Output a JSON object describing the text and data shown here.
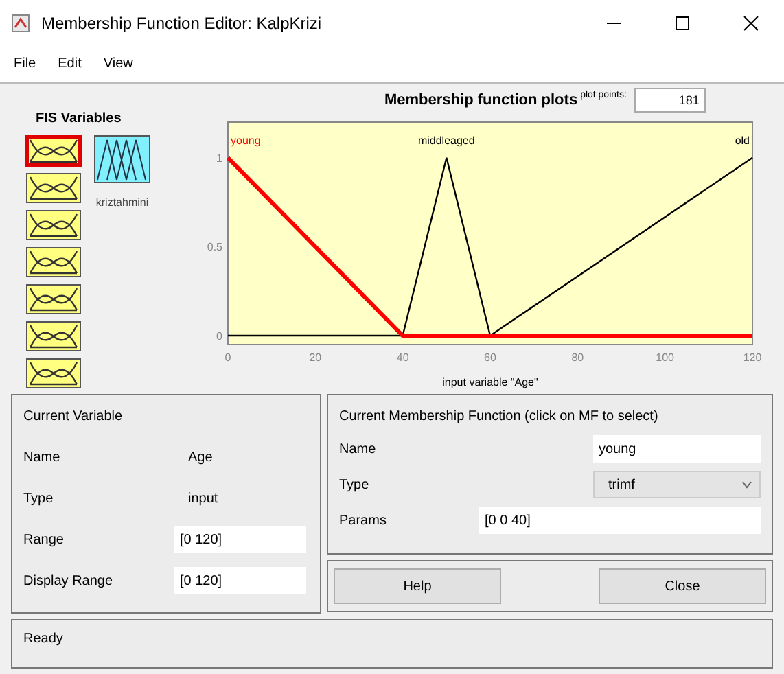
{
  "window": {
    "title": "Membership Function Editor: KalpKrizi"
  },
  "menu": [
    "File",
    "Edit",
    "View"
  ],
  "fis_variables": {
    "title": "FIS Variables",
    "inputs": [
      {
        "selected": true
      },
      {
        "selected": false
      },
      {
        "selected": false
      },
      {
        "selected": false
      },
      {
        "selected": false
      },
      {
        "selected": false
      },
      {
        "selected": false
      }
    ],
    "outputs": [
      {
        "label": "kriztahmini",
        "selected": false
      }
    ]
  },
  "plot": {
    "plot_points_label": "plot points:",
    "plot_points": "181",
    "chart_data": {
      "type": "line",
      "title": "Membership function plots",
      "xlabel": "input variable \"Age\"",
      "x": [
        0,
        40,
        50,
        60,
        120
      ],
      "series": [
        {
          "name": "young",
          "color": "#ff0000",
          "values": [
            1,
            0,
            0,
            0,
            0
          ]
        },
        {
          "name": "middleaged",
          "color": "#000000",
          "values": [
            null,
            0,
            1,
            0,
            null
          ]
        },
        {
          "name": "old",
          "color": "#000000",
          "values": [
            null,
            null,
            null,
            0,
            1
          ]
        }
      ],
      "xlim": [
        0,
        120
      ],
      "ylim": [
        -0.05,
        1.2
      ],
      "xticks": [
        0,
        20,
        40,
        60,
        80,
        100,
        120
      ],
      "yticks": [
        0,
        0.5,
        1
      ]
    },
    "curves": [
      {
        "selected": true
      },
      {
        "selected": false
      },
      {
        "selected": false
      }
    ]
  },
  "current_variable": {
    "title": "Current Variable",
    "rows": [
      {
        "kind": "text",
        "label": "Name",
        "value": "Age"
      },
      {
        "kind": "text",
        "label": "Type",
        "value": "input"
      },
      {
        "kind": "field",
        "label": "Range",
        "value": "[0 120]"
      },
      {
        "kind": "field",
        "label": "Display Range",
        "value": "[0 120]"
      }
    ]
  },
  "current_mf": {
    "title": "Current Membership Function (click on MF to select)",
    "name_label": "Name",
    "name": "young",
    "type_label": "Type",
    "type": "trimf",
    "params_label": "Params",
    "params": "[0 0 40]"
  },
  "buttons": [
    "Help",
    "Close"
  ],
  "status_bar": "Ready"
}
